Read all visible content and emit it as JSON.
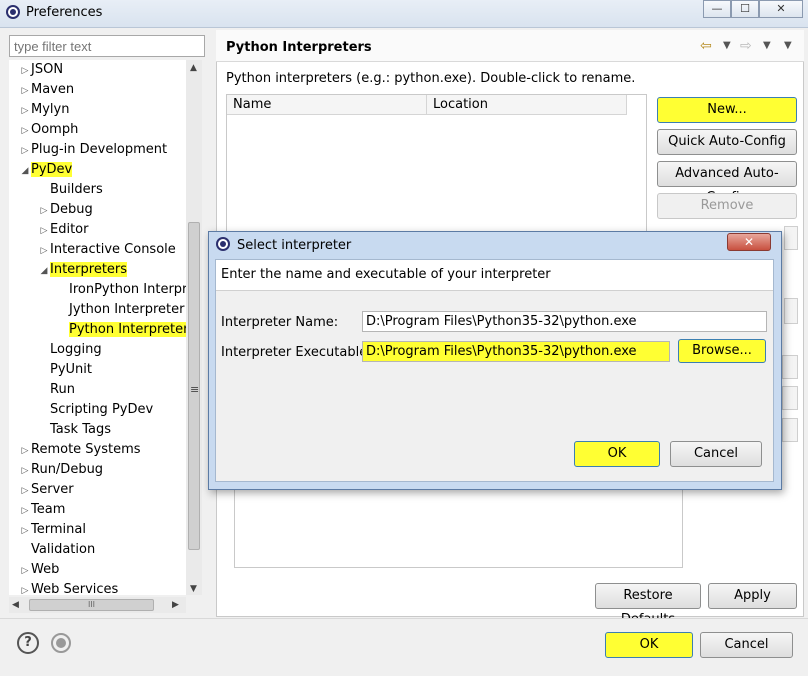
{
  "window": {
    "title": "Preferences",
    "controls": {
      "minimize": "—",
      "maximize": "☐",
      "close": "✕"
    }
  },
  "filter": {
    "placeholder": "type filter text"
  },
  "tree": {
    "items": [
      {
        "label": "JSON",
        "arrow": "▷",
        "indent": 0,
        "highlight": false
      },
      {
        "label": "Maven",
        "arrow": "▷",
        "indent": 0,
        "highlight": false
      },
      {
        "label": "Mylyn",
        "arrow": "▷",
        "indent": 0,
        "highlight": false
      },
      {
        "label": "Oomph",
        "arrow": "▷",
        "indent": 0,
        "highlight": false
      },
      {
        "label": "Plug-in Development",
        "arrow": "▷",
        "indent": 0,
        "highlight": false
      },
      {
        "label": "PyDev",
        "arrow": "◢",
        "indent": 0,
        "highlight": true
      },
      {
        "label": "Builders",
        "arrow": "",
        "indent": 1,
        "highlight": false
      },
      {
        "label": "Debug",
        "arrow": "▷",
        "indent": 1,
        "highlight": false
      },
      {
        "label": "Editor",
        "arrow": "▷",
        "indent": 1,
        "highlight": false
      },
      {
        "label": "Interactive Console",
        "arrow": "▷",
        "indent": 1,
        "highlight": false
      },
      {
        "label": "Interpreters",
        "arrow": "◢",
        "indent": 1,
        "highlight": true
      },
      {
        "label": "IronPython Interpreter",
        "arrow": "",
        "indent": 2,
        "highlight": false
      },
      {
        "label": "Jython Interpreter",
        "arrow": "",
        "indent": 2,
        "highlight": false
      },
      {
        "label": "Python Interpreter",
        "arrow": "",
        "indent": 2,
        "highlight": true
      },
      {
        "label": "Logging",
        "arrow": "",
        "indent": 1,
        "highlight": false
      },
      {
        "label": "PyUnit",
        "arrow": "",
        "indent": 1,
        "highlight": false
      },
      {
        "label": "Run",
        "arrow": "",
        "indent": 1,
        "highlight": false
      },
      {
        "label": "Scripting PyDev",
        "arrow": "",
        "indent": 1,
        "highlight": false
      },
      {
        "label": "Task Tags",
        "arrow": "",
        "indent": 1,
        "highlight": false
      },
      {
        "label": "Remote Systems",
        "arrow": "▷",
        "indent": 0,
        "highlight": false
      },
      {
        "label": "Run/Debug",
        "arrow": "▷",
        "indent": 0,
        "highlight": false
      },
      {
        "label": "Server",
        "arrow": "▷",
        "indent": 0,
        "highlight": false
      },
      {
        "label": "Team",
        "arrow": "▷",
        "indent": 0,
        "highlight": false
      },
      {
        "label": "Terminal",
        "arrow": "▷",
        "indent": 0,
        "highlight": false
      },
      {
        "label": "Validation",
        "arrow": "",
        "indent": 0,
        "highlight": false
      },
      {
        "label": "Web",
        "arrow": "▷",
        "indent": 0,
        "highlight": false
      },
      {
        "label": "Web Services",
        "arrow": "▷",
        "indent": 0,
        "highlight": false
      }
    ],
    "hscroll_grip": "III"
  },
  "page": {
    "title": "Python Interpreters",
    "description": "Python interpreters (e.g.: python.exe).   Double-click to rename.",
    "columns": [
      "Name",
      "Location"
    ],
    "buttons": {
      "new": "New...",
      "quick_auto_config": "Quick Auto-Config",
      "advanced_auto_config": "Advanced Auto-Config",
      "remove": "Remove"
    },
    "restore_defaults": "Restore Defaults",
    "apply": "Apply"
  },
  "footer": {
    "ok": "OK",
    "cancel": "Cancel",
    "help": "?"
  },
  "dialog": {
    "title": "Select interpreter",
    "close": "✕",
    "message": "Enter the name and executable of your interpreter",
    "name_label": "Interpreter Name:",
    "name_value": "D:\\Program Files\\Python35-32\\python.exe",
    "exe_label": "Interpreter Executable:",
    "exe_value": "D:\\Program Files\\Python35-32\\python.exe",
    "browse": "Browse...",
    "ok": "OK",
    "cancel": "Cancel"
  },
  "colors": {
    "highlight": "#ffff33",
    "dialog_frame": "#c8daf0"
  }
}
